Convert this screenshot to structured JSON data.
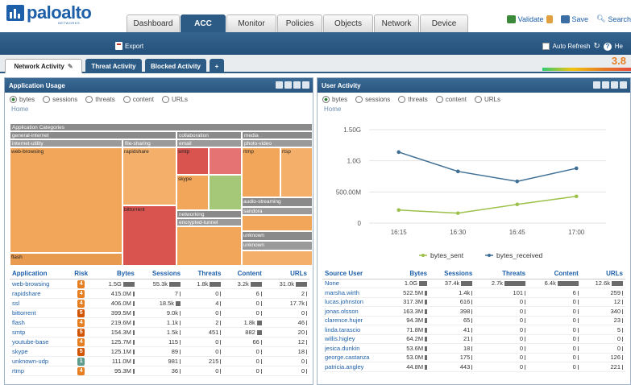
{
  "brand": {
    "logo_text": "paloalto",
    "logo_sub": "NETWORKS"
  },
  "main_tabs": [
    {
      "label": "Dashboard",
      "active": false
    },
    {
      "label": "ACC",
      "active": true
    },
    {
      "label": "Monitor",
      "active": false
    },
    {
      "label": "Policies",
      "active": false
    },
    {
      "label": "Objects",
      "active": false
    },
    {
      "label": "Network",
      "active": false
    },
    {
      "label": "Device",
      "active": false
    }
  ],
  "top_actions": {
    "validate": "Validate",
    "save": "Save",
    "search": "Search"
  },
  "toolbar": {
    "export": "Export",
    "auto_refresh": "Auto Refresh",
    "help": "He"
  },
  "sub_tabs": [
    {
      "label": "Network Activity",
      "active": true
    },
    {
      "label": "Threat Activity",
      "active": false
    },
    {
      "label": "Blocked Activity",
      "active": false
    },
    {
      "label": "+",
      "active": false
    }
  ],
  "risk_score": "3.8",
  "left_panel": {
    "title": "Application Usage",
    "radios": [
      "bytes",
      "sessions",
      "threats",
      "content",
      "URLs"
    ],
    "selected_radio": "bytes",
    "home": "Home",
    "treemap": {
      "headers": [
        "Application Categories",
        "general-internet",
        "collaboration",
        "media",
        "internet-utility",
        "file-sharing",
        "email",
        "photo-video",
        "networking",
        "encrypted-tunnel"
      ],
      "cells": [
        "web-browsing",
        "rapidshare",
        "smtp",
        "rtmp",
        "rtsp",
        "skype",
        "audio-streaming",
        "bittorrent",
        "flash",
        "unknown",
        "unknown",
        "sandora"
      ]
    },
    "columns": [
      "Application",
      "Risk",
      "Bytes",
      "Sessions",
      "Threats",
      "Content",
      "URLs"
    ],
    "rows": [
      {
        "app": "web-browsing",
        "risk": "4",
        "bytes": "1.5G",
        "sessions": "55.3k",
        "threats": "1.8k",
        "content": "3.2k",
        "urls": "31.0k"
      },
      {
        "app": "rapidshare",
        "risk": "4",
        "bytes": "415.0M",
        "sessions": "7",
        "threats": "0",
        "content": "6",
        "urls": "2"
      },
      {
        "app": "ssl",
        "risk": "4",
        "bytes": "406.0M",
        "sessions": "18.5k",
        "threats": "4",
        "content": "0",
        "urls": "17.7k"
      },
      {
        "app": "bittorrent",
        "risk": "5",
        "bytes": "399.5M",
        "sessions": "9.0k",
        "threats": "0",
        "content": "0",
        "urls": "0"
      },
      {
        "app": "flash",
        "risk": "4",
        "bytes": "219.6M",
        "sessions": "1.1k",
        "threats": "2",
        "content": "1.8k",
        "urls": "46"
      },
      {
        "app": "smtp",
        "risk": "5",
        "bytes": "154.3M",
        "sessions": "1.5k",
        "threats": "451",
        "content": "882",
        "urls": "20"
      },
      {
        "app": "youtube-base",
        "risk": "4",
        "bytes": "125.7M",
        "sessions": "115",
        "threats": "0",
        "content": "66",
        "urls": "12"
      },
      {
        "app": "skype",
        "risk": "5",
        "bytes": "125.1M",
        "sessions": "89",
        "threats": "0",
        "content": "0",
        "urls": "18"
      },
      {
        "app": "unknown-udp",
        "risk": "1",
        "bytes": "111.0M",
        "sessions": "981",
        "threats": "215",
        "content": "0",
        "urls": "0"
      },
      {
        "app": "rtmp",
        "risk": "4",
        "bytes": "95.3M",
        "sessions": "36",
        "threats": "0",
        "content": "0",
        "urls": "0"
      }
    ]
  },
  "right_panel": {
    "title": "User Activity",
    "radios": [
      "bytes",
      "sessions",
      "threats",
      "content",
      "URLs"
    ],
    "selected_radio": "bytes",
    "home": "Home",
    "columns": [
      "Source User",
      "Bytes",
      "Sessions",
      "Threats",
      "Content",
      "URLs"
    ],
    "rows": [
      {
        "user": "None",
        "bytes": "1.0G",
        "sessions": "37.4k",
        "threats": "2.7k",
        "content": "6.4k",
        "urls": "12.6k"
      },
      {
        "user": "marsha.wirth",
        "bytes": "522.5M",
        "sessions": "1.4k",
        "threats": "101",
        "content": "6",
        "urls": "259"
      },
      {
        "user": "lucas.johnston",
        "bytes": "317.3M",
        "sessions": "616",
        "threats": "0",
        "content": "0",
        "urls": "12"
      },
      {
        "user": "jonas.olsson",
        "bytes": "163.3M",
        "sessions": "398",
        "threats": "0",
        "content": "0",
        "urls": "340"
      },
      {
        "user": "clarence.hujer",
        "bytes": "94.3M",
        "sessions": "65",
        "threats": "0",
        "content": "0",
        "urls": "23"
      },
      {
        "user": "linda.tarascio",
        "bytes": "71.8M",
        "sessions": "41",
        "threats": "0",
        "content": "0",
        "urls": "5"
      },
      {
        "user": "willis.higley",
        "bytes": "64.2M",
        "sessions": "21",
        "threats": "0",
        "content": "0",
        "urls": "0"
      },
      {
        "user": "jesica.dunkin",
        "bytes": "53.6M",
        "sessions": "18",
        "threats": "0",
        "content": "0",
        "urls": "0"
      },
      {
        "user": "george.castanza",
        "bytes": "53.0M",
        "sessions": "175",
        "threats": "0",
        "content": "0",
        "urls": "126"
      },
      {
        "user": "patricia.angley",
        "bytes": "44.8M",
        "sessions": "443",
        "threats": "0",
        "content": "0",
        "urls": "221"
      }
    ]
  },
  "chart_data": {
    "type": "line",
    "x": [
      "16:15",
      "16:30",
      "16:45",
      "17:00"
    ],
    "y_ticks": [
      "0",
      "500.00M",
      "1.0G",
      "1.50G"
    ],
    "ylim": [
      0,
      1500000000
    ],
    "series": [
      {
        "name": "bytes_sent",
        "color": "#9dc04a",
        "values": [
          210000000,
          160000000,
          300000000,
          430000000
        ]
      },
      {
        "name": "bytes_received",
        "color": "#3f6f95",
        "values": [
          1140000000,
          830000000,
          670000000,
          880000000
        ]
      }
    ]
  },
  "colors": {
    "accent": "#2c5b85",
    "risk4": "#e67e22",
    "risk5": "#d35400",
    "risk1": "#5d9c8c"
  }
}
